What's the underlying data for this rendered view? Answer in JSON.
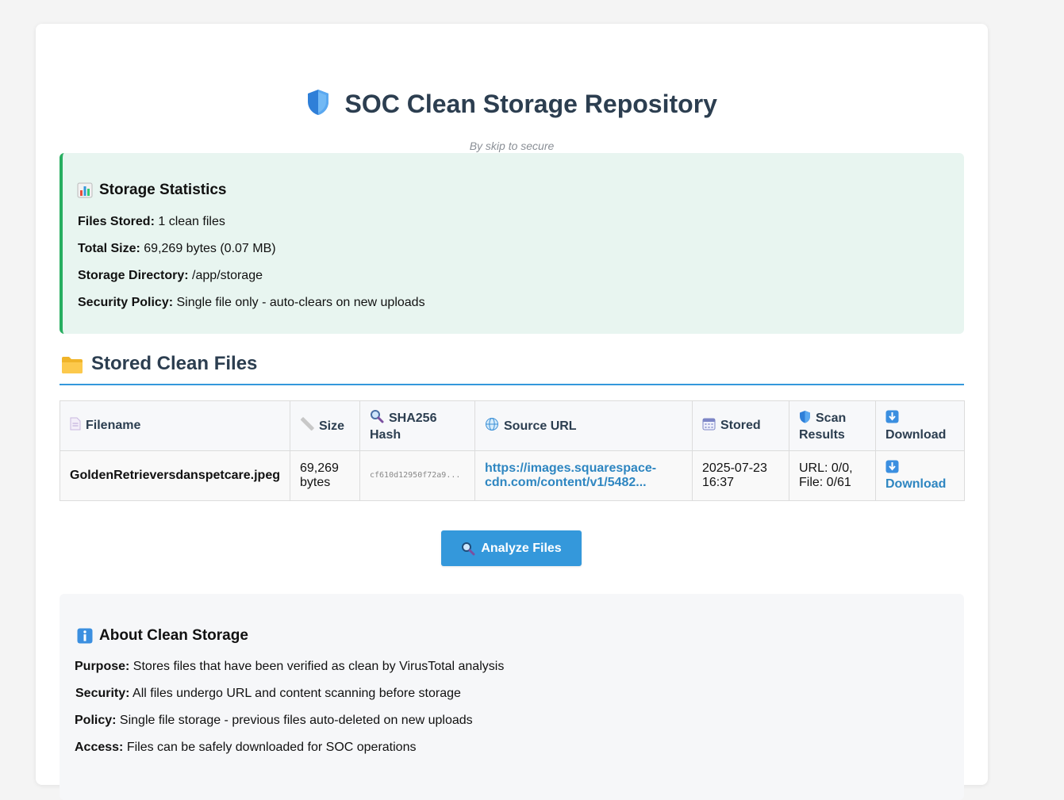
{
  "header": {
    "title": "SOC Clean Storage Repository",
    "byline": "By skip to secure"
  },
  "stats": {
    "heading": "Storage Statistics",
    "items": [
      {
        "label": "Files Stored:",
        "value": "1 clean files"
      },
      {
        "label": "Total Size:",
        "value": "69,269 bytes (0.07 MB)"
      },
      {
        "label": "Storage Directory:",
        "value": "/app/storage"
      },
      {
        "label": "Security Policy:",
        "value": "Single file only - auto-clears on new uploads"
      }
    ]
  },
  "files": {
    "heading": "Stored Clean Files",
    "columns": {
      "filename": "Filename",
      "size": "Size",
      "hash": "SHA256 Hash",
      "source": "Source URL",
      "stored": "Stored",
      "scan": "Scan Results",
      "download": "Download"
    },
    "rows": [
      {
        "filename": "GoldenRetrieversdanspetcare.jpeg",
        "size": "69,269 bytes",
        "hash": "cf610d12950f72a9...",
        "source": "https://images.squarespace-cdn.com/content/v1/5482...",
        "stored": "2025-07-23 16:37",
        "scan": "URL: 0/0, File: 0/61",
        "download": "Download"
      }
    ]
  },
  "actions": {
    "analyze_label": "Analyze Files"
  },
  "about": {
    "heading": "About Clean Storage",
    "items": [
      {
        "label": "Purpose:",
        "value": "Stores files that have been verified as clean by VirusTotal analysis"
      },
      {
        "label": "Security:",
        "value": "All files undergo URL and content scanning before storage"
      },
      {
        "label": "Policy:",
        "value": "Single file storage - previous files auto-deleted on new uploads"
      },
      {
        "label": "Access:",
        "value": "Files can be safely downloaded for SOC operations"
      }
    ]
  },
  "colors": {
    "accent": "#3498db",
    "heading": "#2c3e50",
    "stats_border": "#27ae60",
    "stats_bg": "#e8f5f0",
    "link": "#2e86c1"
  },
  "icons": {
    "title": "shield-icon",
    "stats": "bar-chart-icon",
    "files": "folder-icon",
    "filename": "document-icon",
    "size": "ruler-icon",
    "hash": "magnifier-icon",
    "source": "globe-icon",
    "stored": "calendar-icon",
    "scan": "shield-icon",
    "download": "download-arrow-icon",
    "analyze": "magnifier-icon",
    "about": "info-icon"
  }
}
